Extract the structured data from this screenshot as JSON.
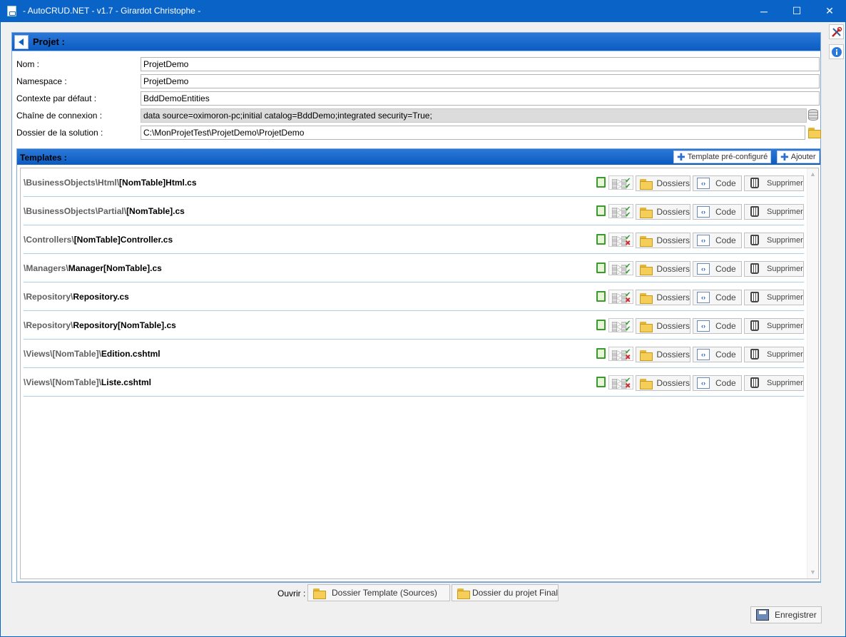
{
  "window": {
    "title": "- AutoCRUD.NET - v1.7 - Girardot Christophe -",
    "minimize": "─",
    "maximize": "☐",
    "close": "✕"
  },
  "project": {
    "header": "Projet :",
    "fields": [
      {
        "label": "Nom :",
        "value": "ProjetDemo"
      },
      {
        "label": "Namespace :",
        "value": "ProjetDemo"
      },
      {
        "label": "Contexte par défaut :",
        "value": "BddDemoEntities"
      },
      {
        "label": "Chaîne de connexion :",
        "value": "data source=oximoron-pc;initial catalog=BddDemo;integrated security=True;"
      },
      {
        "label": "Dossier de la solution :",
        "value": "C:\\MonProjetTest\\ProjetDemo\\ProjetDemo"
      }
    ]
  },
  "templates": {
    "header": "Templates :",
    "preconfigured_label": "Template pré-configuré",
    "add_label": "Ajouter",
    "folders_label": "Dossiers",
    "code_label": "Code",
    "delete_label": "Supprimer",
    "items": [
      {
        "dir": "\\BusinessObjects\\Html\\",
        "file": "[NomTable]Html.cs",
        "status": "ok"
      },
      {
        "dir": "\\BusinessObjects\\Partial\\",
        "file": "[NomTable].cs",
        "status": "ok"
      },
      {
        "dir": "\\Controllers\\",
        "file": "[NomTable]Controller.cs",
        "status": "ko"
      },
      {
        "dir": "\\Managers\\",
        "file": "Manager[NomTable].cs",
        "status": "ok"
      },
      {
        "dir": "\\Repository\\",
        "file": "Repository.cs",
        "status": "ko"
      },
      {
        "dir": "\\Repository\\",
        "file": "Repository[NomTable].cs",
        "status": "ok"
      },
      {
        "dir": "\\Views\\[NomTable]\\",
        "file": "Edition.cshtml",
        "status": "ko"
      },
      {
        "dir": "\\Views\\[NomTable]\\",
        "file": "Liste.cshtml",
        "status": "ko"
      }
    ]
  },
  "footer": {
    "open_label": "Ouvrir :",
    "template_folder": "Dossier Template (Sources)",
    "project_folder": "Dossier du projet Final",
    "save": "Enregistrer"
  },
  "icons": {
    "settings": "tools-icon",
    "info": "info-icon",
    "back": "back-arrow-icon"
  }
}
